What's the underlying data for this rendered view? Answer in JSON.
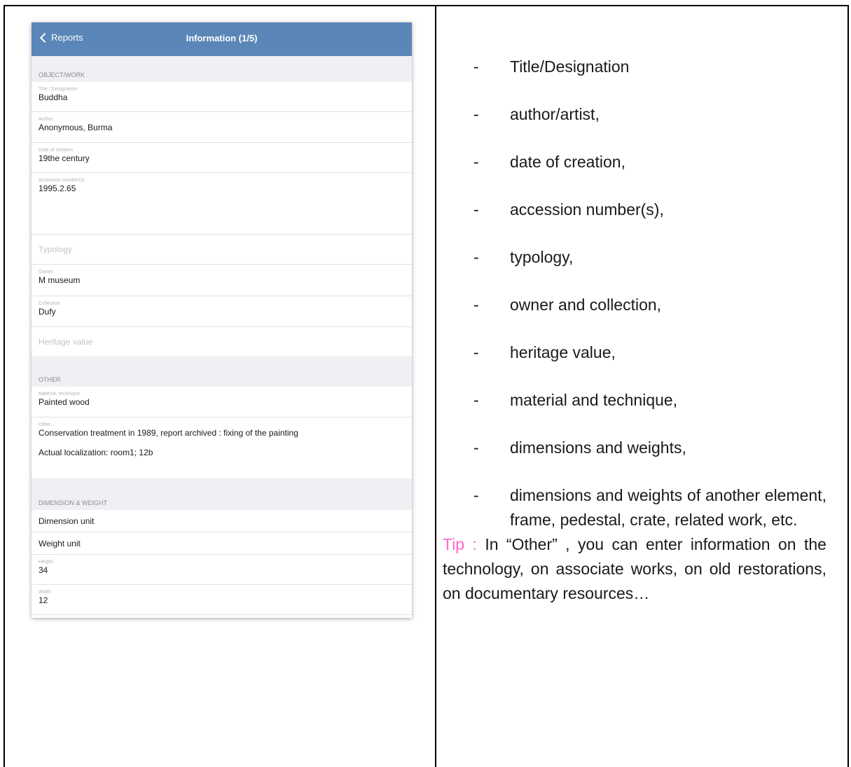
{
  "app": {
    "back_label": "Reports",
    "title": "Information (1/5)"
  },
  "sections": {
    "object_work": "OBJECT/WORK",
    "other": "OTHER",
    "dimension_weight": "DIMENSION & WEIGHT"
  },
  "fields": {
    "title": {
      "label": "Title / Designation",
      "value": "Buddha"
    },
    "author": {
      "label": "Author",
      "value": "Anonymous, Burma"
    },
    "date": {
      "label": "Date of creation",
      "value": "19the century"
    },
    "accession": {
      "label": "Accession number(s)",
      "value": "1995.2.65"
    },
    "typology": {
      "placeholder": "Typology"
    },
    "owner": {
      "label": "Owner",
      "value": "M museum"
    },
    "collection": {
      "label": "Collection",
      "value": "Dufy"
    },
    "heritage": {
      "placeholder": "Heritage value"
    },
    "material": {
      "label": "Material, technique",
      "value": "Painted wood"
    },
    "other": {
      "label": "Other...",
      "value_line1": "Conservation treatment in 1989, report archived : fixing of the painting",
      "value_line2": "Actual localization: room1; 12b"
    },
    "dimension_unit": {
      "value": "Dimension unit"
    },
    "weight_unit": {
      "value": "Weight unit"
    },
    "height": {
      "label": "Height",
      "value": "34"
    },
    "width": {
      "label": "Width",
      "value": "12"
    }
  },
  "bullets": [
    "Title/Designation",
    "author/artist,",
    "date of creation,",
    "accession number(s),",
    "typology,",
    "owner and collection,",
    "heritage value,",
    "material and technique,",
    "dimensions and  weights,",
    "dimensions and  weights of another element, frame, pedestal, crate, related work, etc."
  ],
  "dash": "-",
  "tip": {
    "label": "Tip :",
    "text": " In “Other” , you can enter information on the technology, on associate works, on old restorations, on documentary resources…"
  }
}
